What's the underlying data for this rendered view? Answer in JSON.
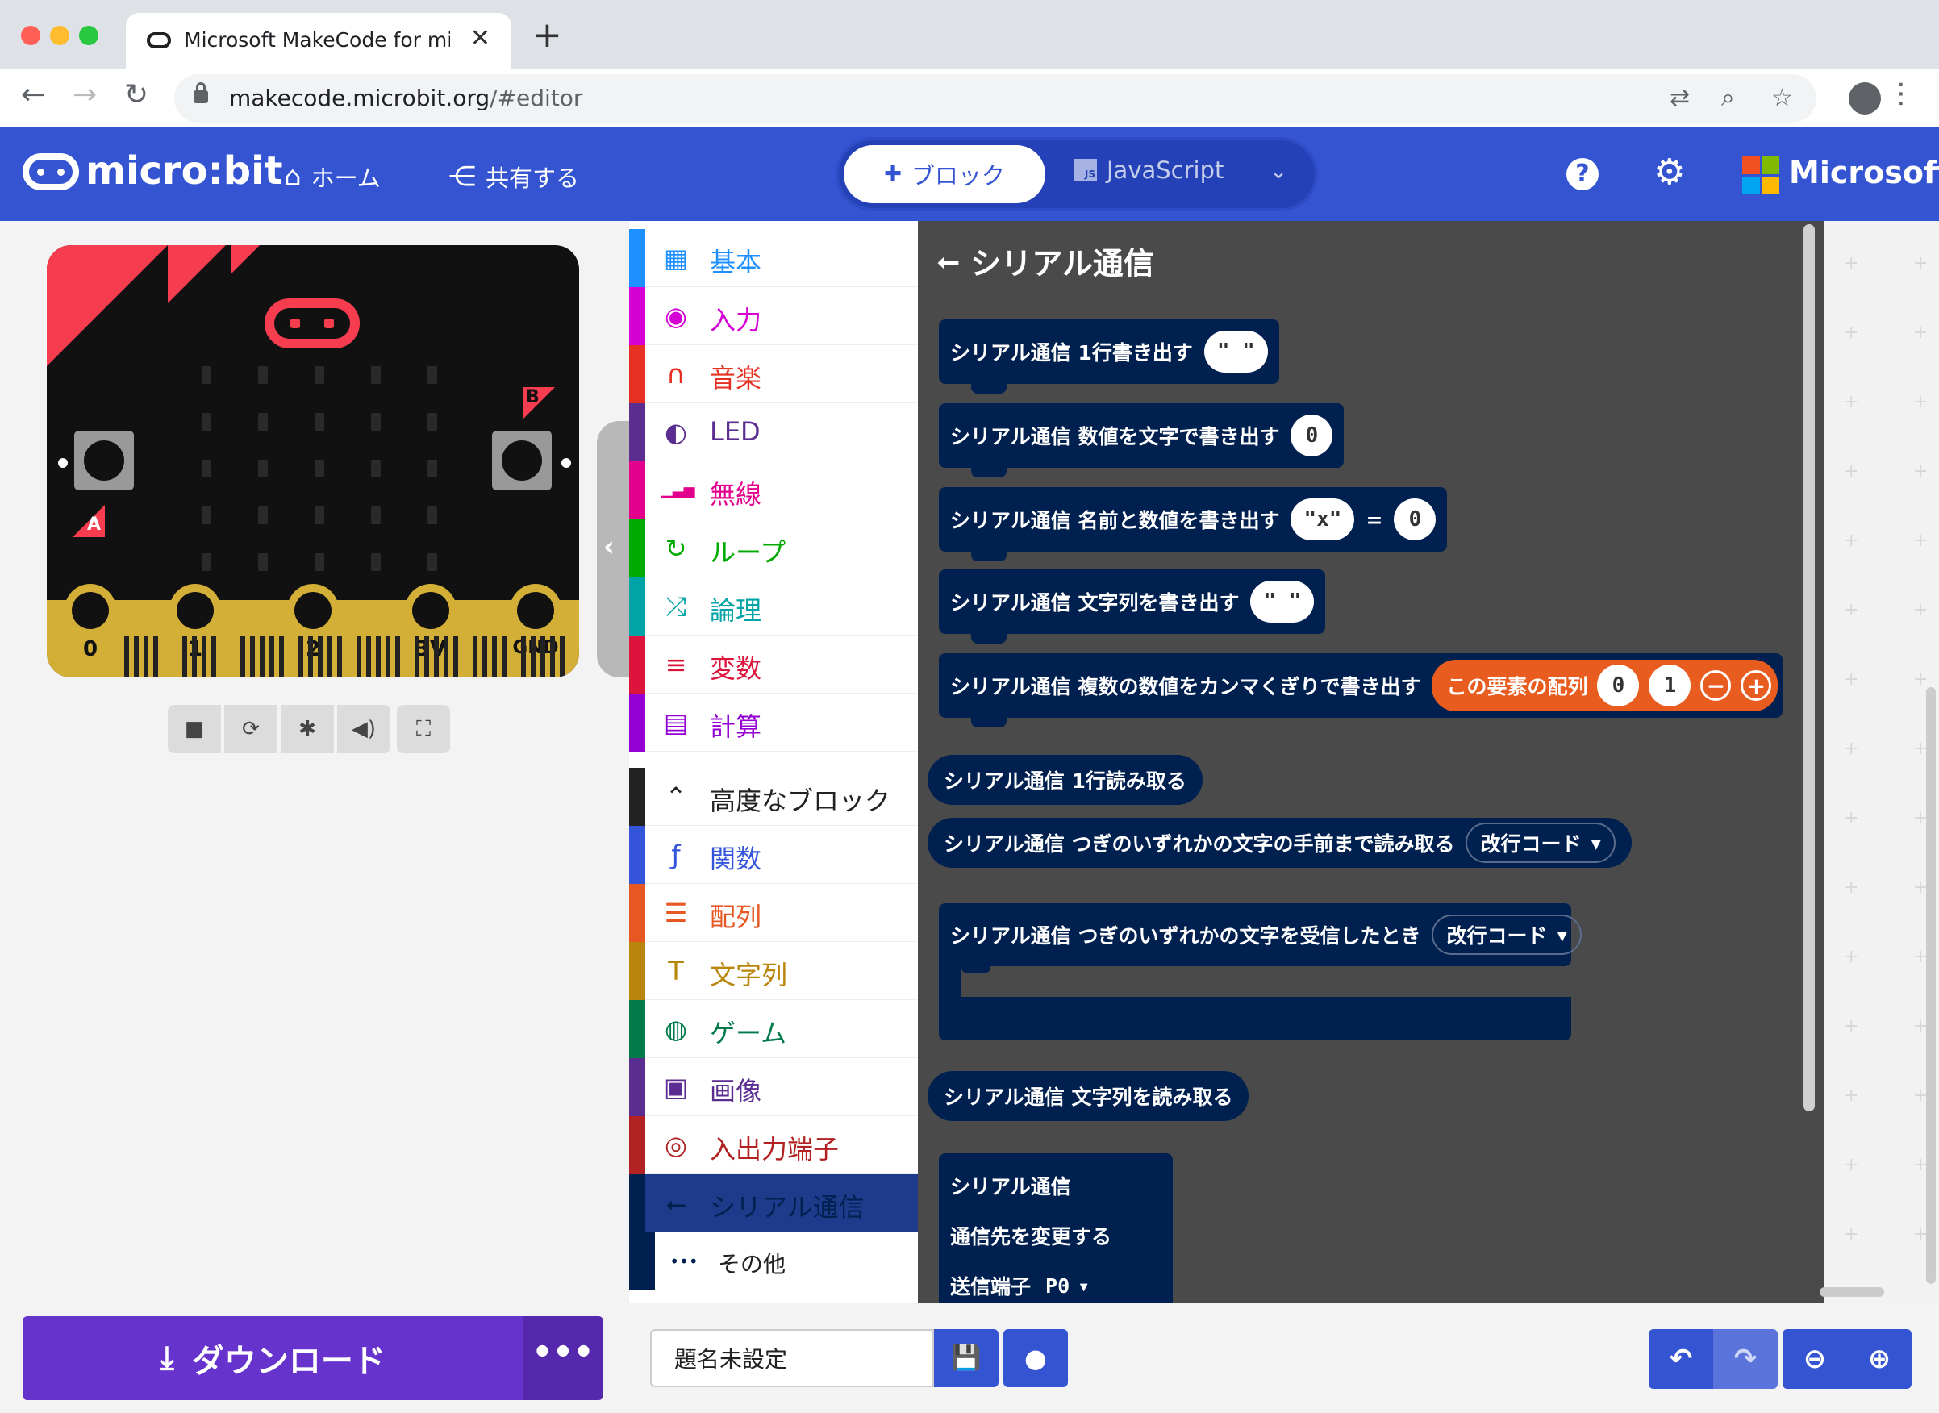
{
  "browser": {
    "tab_title": "Microsoft MakeCode for micro:bit",
    "tab_close": "✕",
    "new_tab": "+",
    "url_host": "makecode.microbit.org",
    "url_path": "/#editor"
  },
  "header": {
    "brand": "micro:bit",
    "home_label": "ホーム",
    "share_label": "共有する",
    "blocks_label": "ブロック",
    "javascript_label": "JavaScript",
    "help_label": "?",
    "microsoft_label": "Microsoft",
    "microsoft_colors": [
      "#f25022",
      "#7fba00",
      "#00a4ef",
      "#ffb900"
    ],
    "accent_color": "#3454d1"
  },
  "simulator": {
    "button_a": "A",
    "button_b": "B",
    "pins": [
      "0",
      "1",
      "2",
      "3V",
      "GND"
    ]
  },
  "toolbox": {
    "categories": [
      {
        "label": "基本",
        "icon": "grid-icon",
        "color": "#1e90ff"
      },
      {
        "label": "入力",
        "icon": "input-icon",
        "color": "#d400d4"
      },
      {
        "label": "音楽",
        "icon": "headphones-icon",
        "color": "#e63022"
      },
      {
        "label": "LED",
        "icon": "toggle-icon",
        "color": "#5c2d91"
      },
      {
        "label": "無線",
        "icon": "signal-icon",
        "color": "#e3008c"
      },
      {
        "label": "ループ",
        "icon": "loop-icon",
        "color": "#00aa00"
      },
      {
        "label": "論理",
        "icon": "shuffle-icon",
        "color": "#00a4a6"
      },
      {
        "label": "変数",
        "icon": "lines-icon",
        "color": "#dc143c"
      },
      {
        "label": "計算",
        "icon": "calculator-icon",
        "color": "#9400d3"
      },
      {
        "label": "高度なブロック",
        "icon": "chevron-up-icon",
        "color": "#222222"
      },
      {
        "label": "関数",
        "icon": "function-icon",
        "color": "#3455db"
      },
      {
        "label": "配列",
        "icon": "list-icon",
        "color": "#e65722"
      },
      {
        "label": "文字列",
        "icon": "text-icon",
        "color": "#b8860b"
      },
      {
        "label": "ゲーム",
        "icon": "gamepad-icon",
        "color": "#007a4b"
      },
      {
        "label": "画像",
        "icon": "image-icon",
        "color": "#5c2d91"
      },
      {
        "label": "入出力端子",
        "icon": "target-icon",
        "color": "#b22222"
      },
      {
        "label": "シリアル通信",
        "icon": "usb-icon",
        "color": "#002050"
      },
      {
        "label": "その他",
        "icon": "more-icon",
        "color": "#002050"
      }
    ]
  },
  "flyout": {
    "title": "シリアル通信",
    "blocks": {
      "write_line": "シリアル通信 1行書き出す",
      "write_line_arg": "\" \"",
      "write_number": "シリアル通信 数値を文字で書き出す",
      "write_number_arg": "0",
      "write_value": "シリアル通信 名前と数値を書き出す",
      "write_value_name": "\"x\"",
      "write_value_eq": "=",
      "write_value_num": "0",
      "write_string": "シリアル通信 文字列を書き出す",
      "write_string_arg": "\" \"",
      "write_numbers": "シリアル通信 複数の数値をカンマくぎりで書き出す",
      "array_label": "この要素の配列",
      "array_v0": "0",
      "array_v1": "1",
      "read_line": "シリアル通信 1行読み取る",
      "read_until": "シリアル通信 つぎのいずれかの文字の手前まで読み取る",
      "read_until_opt": "改行コード",
      "on_data": "シリアル通信 つぎのいずれかの文字を受信したとき",
      "on_data_opt": "改行コード",
      "read_string": "シリアル通信 文字列を読み取る",
      "redirect_1": "シリアル通信",
      "redirect_2": "通信先を変更する",
      "redirect_3": "送信端子",
      "redirect_pin": "P0"
    }
  },
  "bottom": {
    "download_label": "ダウンロード",
    "more_label": "•••",
    "project_name": "題名未設定"
  }
}
